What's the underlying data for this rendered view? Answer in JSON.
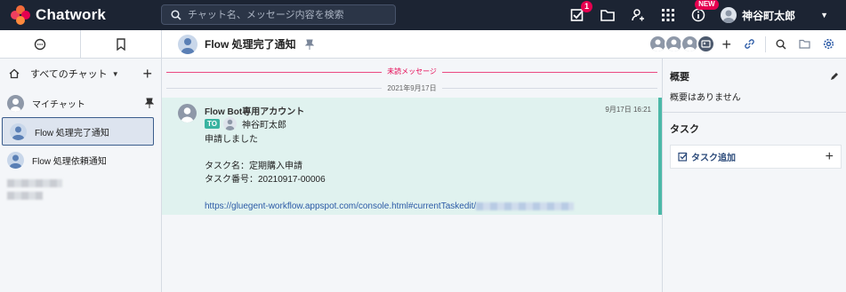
{
  "app": {
    "logo_text": "Chatwork",
    "search_placeholder": "チャット名、メッセージ内容を検索",
    "task_badge": "1",
    "new_badge": "NEW",
    "user_name": "神谷町太郎",
    "colors": {
      "topbar": "#1c2433",
      "accent": "#e5004f",
      "mention": "#39b3a0"
    }
  },
  "sidebar": {
    "filter_label": "すべてのチャット",
    "rooms": [
      {
        "name": "マイチャット",
        "pinned": true
      },
      {
        "name": "Flow 処理完了通知",
        "active": true
      },
      {
        "name": "Flow 処理依頼通知"
      }
    ]
  },
  "room": {
    "title": "Flow 処理完了通知"
  },
  "timeline": {
    "unread_label": "未読メッセージ",
    "date_label": "2021年9月17日",
    "message": {
      "sender": "Flow Bot専用アカウント",
      "time": "9月17日 16:21",
      "to_label": "TO",
      "to_name": "神谷町太郎",
      "body": "申請しました\n\nタスク名：定期購入申請\nタスク番号：20210917-00006\n\n",
      "link": "https://gluegent-workflow.appspot.com/console.html#currentTaskedit/"
    }
  },
  "right_panel": {
    "summary_title": "概要",
    "summary_text": "概要はありません",
    "task_title": "タスク",
    "task_add_label": "タスク追加"
  }
}
